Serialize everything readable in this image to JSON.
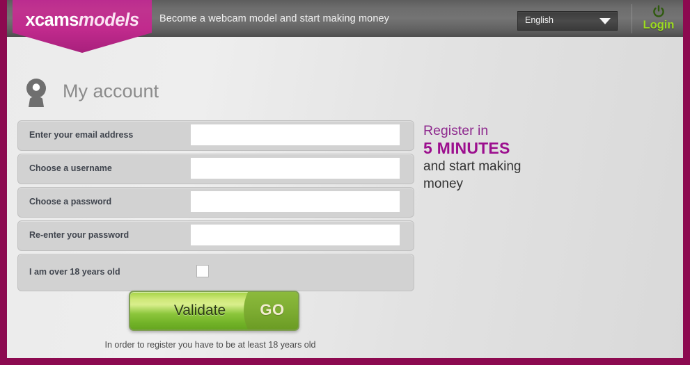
{
  "header": {
    "tagline": "Become a webcam model and start making money",
    "language": {
      "selected": "English",
      "caret_icon": "chevron-down-icon"
    },
    "login": {
      "label": "Login",
      "icon": "power-icon"
    }
  },
  "logo": {
    "part1": "xcams",
    "part2": "models"
  },
  "account": {
    "title": "My account",
    "icon": "webcam-user-icon"
  },
  "form": {
    "rows": [
      {
        "label": "Enter your email address",
        "type": "text",
        "value": "",
        "placeholder": "",
        "name": "email-field"
      },
      {
        "label": "Choose a username",
        "type": "text",
        "value": "",
        "placeholder": "",
        "name": "username-field"
      },
      {
        "label": "Choose a password",
        "type": "password",
        "value": "",
        "placeholder": "",
        "name": "password-field"
      },
      {
        "label": "Re-enter your password",
        "type": "password",
        "value": "",
        "placeholder": "",
        "name": "confirm-password-field"
      },
      {
        "label": "I am over 18 years old",
        "type": "checkbox",
        "checked": false,
        "name": "age-confirmation-checkbox"
      }
    ],
    "submit": {
      "label": "Validate",
      "badge": "GO"
    },
    "note": "In order to register you have to be at least 18 years old"
  },
  "promo": {
    "line1": "Register in",
    "line2": "5 MINUTES",
    "line3": "and start making money"
  },
  "colors": {
    "frame": "#8c0a50",
    "brand_magenta": "#c12a8d",
    "promo_purple": "#9c0f8e",
    "login_green": "#9cdb21",
    "button_green": "#8cc63c"
  }
}
